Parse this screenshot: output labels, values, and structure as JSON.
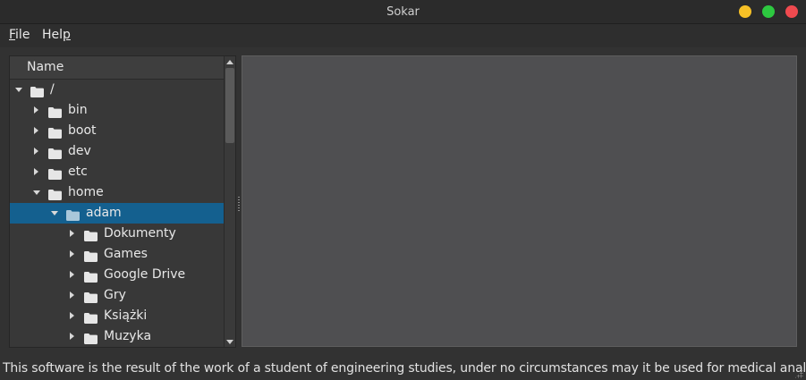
{
  "window": {
    "title": "Sokar"
  },
  "menu": {
    "file": {
      "mnemonic": "F",
      "rest": "ile"
    },
    "help": {
      "prefix": "Hel",
      "mnemonic": "p"
    }
  },
  "tree": {
    "header": "Name",
    "rows": [
      {
        "label": "/",
        "state": "expanded",
        "depth": 0,
        "selected": false
      },
      {
        "label": "bin",
        "state": "collapsed",
        "depth": 1,
        "selected": false
      },
      {
        "label": "boot",
        "state": "collapsed",
        "depth": 1,
        "selected": false
      },
      {
        "label": "dev",
        "state": "collapsed",
        "depth": 1,
        "selected": false
      },
      {
        "label": "etc",
        "state": "collapsed",
        "depth": 1,
        "selected": false
      },
      {
        "label": "home",
        "state": "expanded",
        "depth": 1,
        "selected": false
      },
      {
        "label": "adam",
        "state": "expanded",
        "depth": 2,
        "selected": true
      },
      {
        "label": "Dokumenty",
        "state": "collapsed",
        "depth": 3,
        "selected": false
      },
      {
        "label": "Games",
        "state": "collapsed",
        "depth": 3,
        "selected": false
      },
      {
        "label": "Google Drive",
        "state": "collapsed",
        "depth": 3,
        "selected": false
      },
      {
        "label": "Gry",
        "state": "collapsed",
        "depth": 3,
        "selected": false
      },
      {
        "label": "Książki",
        "state": "collapsed",
        "depth": 3,
        "selected": false
      },
      {
        "label": "Muzyka",
        "state": "collapsed",
        "depth": 3,
        "selected": false
      }
    ],
    "icons": {
      "folder": "folder-icon",
      "expanded": "chevron-down-icon",
      "collapsed": "chevron-right-icon"
    }
  },
  "status": {
    "text": "This software is the result of the work of a student of engineering studies, under no circumstances may it be used for medical analysis"
  },
  "colors": {
    "selection": "#14608f",
    "folder": "#e6e6e6",
    "folder_selected": "#a9c7da",
    "minimize": "#f6c026",
    "maximize": "#2dc840",
    "close": "#f04a4f"
  }
}
